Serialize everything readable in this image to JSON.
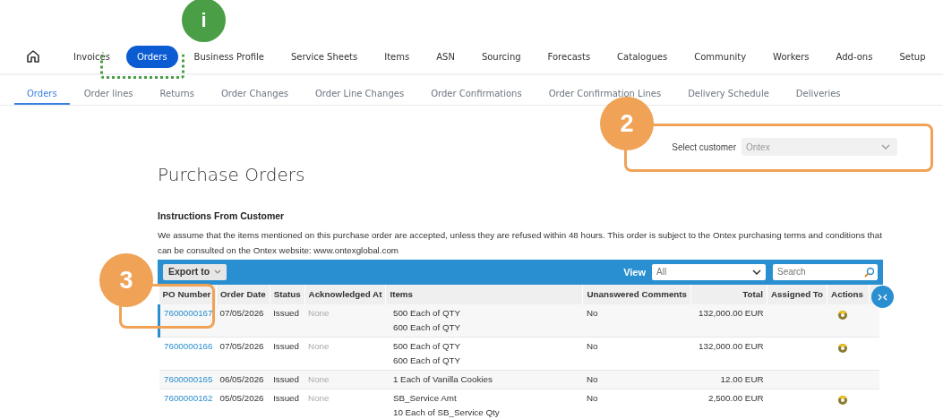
{
  "main_nav": [
    {
      "label": "Invoices",
      "selected": false
    },
    {
      "label": "Orders",
      "selected": true
    },
    {
      "label": "Business Profile",
      "selected": false
    },
    {
      "label": "Service Sheets",
      "selected": false
    },
    {
      "label": "Items",
      "selected": false
    },
    {
      "label": "ASN",
      "selected": false
    },
    {
      "label": "Sourcing",
      "selected": false
    },
    {
      "label": "Forecasts",
      "selected": false
    },
    {
      "label": "Catalogues",
      "selected": false
    },
    {
      "label": "Community",
      "selected": false
    },
    {
      "label": "Workers",
      "selected": false
    },
    {
      "label": "Add-ons",
      "selected": false
    },
    {
      "label": "Setup",
      "selected": false
    }
  ],
  "sub_nav": [
    {
      "label": "Orders",
      "selected": true
    },
    {
      "label": "Order lines",
      "selected": false
    },
    {
      "label": "Returns",
      "selected": false
    },
    {
      "label": "Order Changes",
      "selected": false
    },
    {
      "label": "Order Line Changes",
      "selected": false
    },
    {
      "label": "Order Confirmations",
      "selected": false
    },
    {
      "label": "Order Confirmation Lines",
      "selected": false
    },
    {
      "label": "Delivery Schedule",
      "selected": false
    },
    {
      "label": "Deliveries",
      "selected": false
    }
  ],
  "customer_select": {
    "label": "Select customer",
    "value": "Ontex",
    "disabled": true
  },
  "page_title": "Purchase Orders",
  "instructions": {
    "title": "Instructions From Customer",
    "text": "We assume that the items mentioned on this purchase order are accepted, unless they are refused within 48 hours. This order is subject to the Ontex purchasing terms and conditions that can be consulted on the Ontex website: www.ontexglobal.com"
  },
  "toolbar": {
    "export_label": "Export to",
    "view_label": "View",
    "view_value": "All",
    "search_placeholder": "Search"
  },
  "table": {
    "columns": [
      "PO Number",
      "Order Date",
      "Status",
      "Acknowledged At",
      "Items",
      "Unanswered Comments",
      "Total",
      "Assigned To",
      "Actions"
    ],
    "rows": [
      {
        "po_number": "7600000167",
        "order_date": "07/05/2026",
        "status": "Issued",
        "acknowledged_at": "None",
        "items": [
          "500 Each of QTY",
          "600 Each of QTY"
        ],
        "unanswered_comments": "No",
        "total": "132,000.00 EUR",
        "has_action": true,
        "selected": true
      },
      {
        "po_number": "7600000166",
        "order_date": "07/05/2026",
        "status": "Issued",
        "acknowledged_at": "None",
        "items": [
          "500 Each of QTY",
          "600 Each of QTY"
        ],
        "unanswered_comments": "No",
        "total": "132,000.00 EUR",
        "has_action": true,
        "selected": false
      },
      {
        "po_number": "7600000165",
        "order_date": "06/05/2026",
        "status": "Issued",
        "acknowledged_at": "None",
        "items": [
          "1 Each of Vanilla Cookies"
        ],
        "unanswered_comments": "No",
        "total": "12.00 EUR",
        "has_action": false,
        "selected": false
      },
      {
        "po_number": "7600000162",
        "order_date": "05/05/2026",
        "status": "Issued",
        "acknowledged_at": "None",
        "items": [
          "SB_Service Amt",
          "10 Each of SB_Service Qty"
        ],
        "unanswered_comments": "No",
        "total": "2,500.00 EUR",
        "has_action": true,
        "selected": false
      }
    ]
  },
  "callouts": [
    {
      "label": "i",
      "color": "#4a9e45"
    },
    {
      "label": "2",
      "color": "#f0a257"
    },
    {
      "label": "3",
      "color": "#f0a257"
    }
  ]
}
